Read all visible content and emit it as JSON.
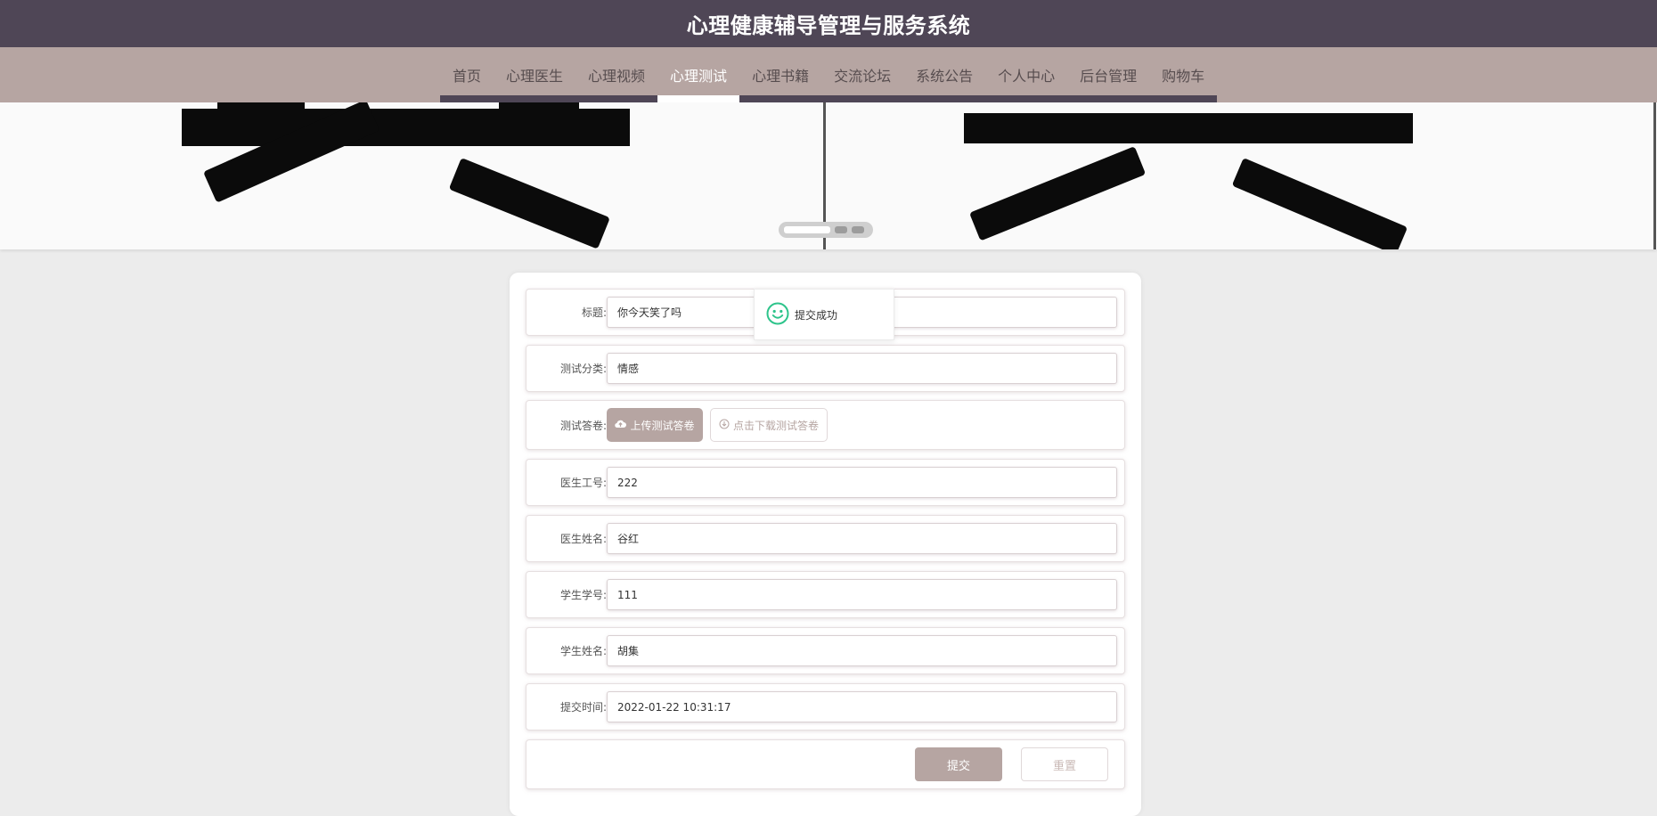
{
  "app": {
    "title": "心理健康辅导管理与服务系统"
  },
  "nav": {
    "items": [
      {
        "label": "首页"
      },
      {
        "label": "心理医生"
      },
      {
        "label": "心理视频"
      },
      {
        "label": "心理测试"
      },
      {
        "label": "心理书籍"
      },
      {
        "label": "交流论坛"
      },
      {
        "label": "系统公告"
      },
      {
        "label": "个人中心"
      },
      {
        "label": "后台管理"
      },
      {
        "label": "购物车"
      }
    ],
    "active": "心理测试"
  },
  "toast": {
    "icon": "smile-icon",
    "message": "提交成功",
    "color": "#2ec48b"
  },
  "form": {
    "title": {
      "label": "标题:",
      "value": "你今天笑了吗"
    },
    "category": {
      "label": "测试分类:",
      "value": "情感"
    },
    "answer_sheet": {
      "label": "测试答卷:",
      "upload_label": "上传测试答卷",
      "download_label": "点击下载测试答卷"
    },
    "doctor_id": {
      "label": "医生工号:",
      "value": "222"
    },
    "doctor_name": {
      "label": "医生姓名:",
      "value": "谷红"
    },
    "student_id": {
      "label": "学生学号:",
      "value": "111"
    },
    "student_name": {
      "label": "学生姓名:",
      "value": "胡集"
    },
    "submit_time": {
      "label": "提交时间:",
      "value": "2022-01-22 10:31:17"
    },
    "submit_label": "提交",
    "reset_label": "重置"
  },
  "colors": {
    "header": "#4f4656",
    "nav": "#b6a5a2",
    "accent": "#b6a5a2",
    "background": "#ececec"
  }
}
